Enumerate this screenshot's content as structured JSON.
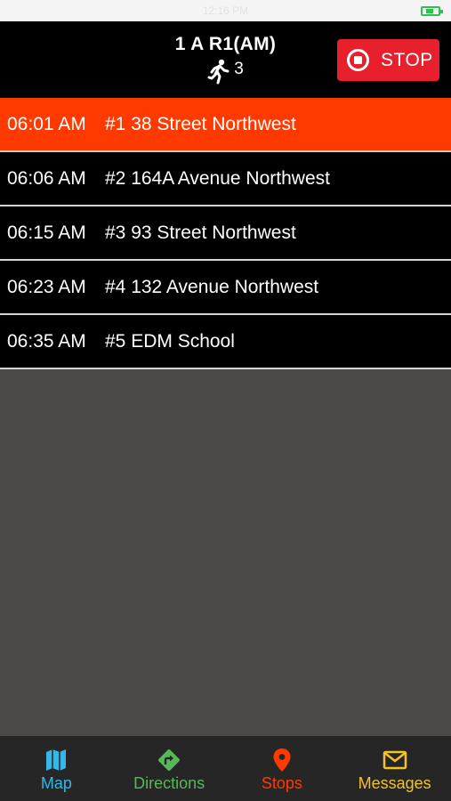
{
  "status_bar": {
    "time": "12:16 PM"
  },
  "header": {
    "route_title": "1 A R1(AM)",
    "passenger_icon": "running-person-icon",
    "passenger_count": "3",
    "stop_button_label": "STOP",
    "stop_button_color": "#e8202e"
  },
  "stops": [
    {
      "time": "06:01 AM",
      "name": "#1 38 Street Northwest",
      "active": true
    },
    {
      "time": "06:06 AM",
      "name": "#2 164A Avenue Northwest",
      "active": false
    },
    {
      "time": "06:15 AM",
      "name": "#3 93 Street Northwest",
      "active": false
    },
    {
      "time": "06:23 AM",
      "name": "#4 132 Avenue Northwest",
      "active": false
    },
    {
      "time": "06:35 AM",
      "name": "#5 EDM School",
      "active": false
    }
  ],
  "colors": {
    "active_stop": "#ff3a00",
    "map": "#35b7e8",
    "directions": "#57b85a",
    "stops": "#ff3a00",
    "messages": "#f3c325"
  },
  "tabs": [
    {
      "label": "Map",
      "icon": "map-icon"
    },
    {
      "label": "Directions",
      "icon": "directions-icon"
    },
    {
      "label": "Stops",
      "icon": "location-pin-icon"
    },
    {
      "label": "Messages",
      "icon": "envelope-icon"
    }
  ]
}
